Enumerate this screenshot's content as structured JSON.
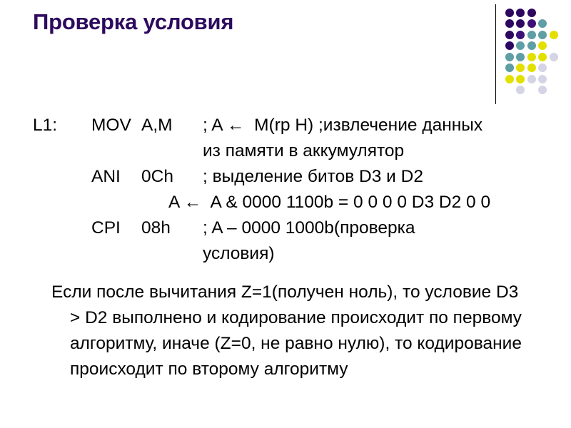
{
  "slide": {
    "title": "Проверка условия",
    "title_color": "#2d0a5e",
    "background_color": "#ffffff",
    "text_color": "#000000"
  },
  "decoration": {
    "name": "dot-grid-decoration",
    "rule_color": "#000000",
    "palette": {
      "dark_purple": "#2e0760",
      "mid_purple": "#3d1177",
      "teal": "#5f9ea4",
      "yellow": "#e3e000",
      "lavender": "#d4d4e6"
    },
    "grid": [
      [
        "dark_purple",
        "dark_purple",
        "dark_purple",
        "none",
        "none"
      ],
      [
        "dark_purple",
        "dark_purple",
        "mid_purple",
        "teal",
        "none"
      ],
      [
        "dark_purple",
        "mid_purple",
        "teal",
        "teal",
        "yellow"
      ],
      [
        "dark_purple",
        "teal",
        "teal",
        "yellow",
        "none"
      ],
      [
        "teal",
        "teal",
        "yellow",
        "yellow",
        "lavender"
      ],
      [
        "teal",
        "yellow",
        "yellow",
        "lavender",
        "none"
      ],
      [
        "yellow",
        "yellow",
        "lavender",
        "lavender",
        "none"
      ],
      [
        "none",
        "lavender",
        "none",
        "lavender",
        "none"
      ]
    ]
  },
  "code_block": {
    "lines": [
      {
        "label": "L1:",
        "mnemonic": "MOV",
        "operand": "A,M",
        "comment": "; A ←  M(rp H) ;извлечение данных",
        "continuation": "из памяти в аккумулятор"
      },
      {
        "label": "",
        "mnemonic": "ANI",
        "operand": "0Ch",
        "comment": "; выделение битов D3 и D2",
        "expression": "A ←  A & 0000 1100b = 0 0 0 0 D3 D2 0 0"
      },
      {
        "label": "",
        "mnemonic": "CPI",
        "operand": "08h",
        "comment": "; A – 0000 1000b(проверка",
        "continuation": "условия)"
      }
    ]
  },
  "paragraph": {
    "text": "Если после вычитания Z=1(получен ноль), то условие D3 > D2 выполнено и кодирование происходит по первому алгоритму, иначе (Z=0, не равно нулю), то кодирование происходит по второму алгоритму"
  }
}
